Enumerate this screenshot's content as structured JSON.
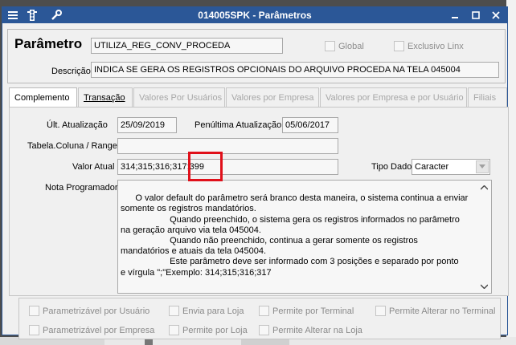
{
  "window": {
    "title": "014005SPK - Parâmetros",
    "accent": "#2b5797"
  },
  "toolbar_icons": [
    "list-icon",
    "traffic-light-icon",
    "wrench-icon"
  ],
  "header": {
    "parametro_label": "Parâmetro",
    "parametro_value": "UTILIZA_REG_CONV_PROCEDA",
    "global_label": "Global",
    "exclusivo_label": "Exclusivo Linx",
    "descricao_label": "Descrição",
    "descricao_value": "INDICA SE GERA OS REGISTROS OPCIONAIS DO ARQUIVO PROCEDA NA TELA 045004"
  },
  "tabs": [
    {
      "label": "Complemento"
    },
    {
      "label": "Transação"
    },
    {
      "label": "Valores Por Usuários"
    },
    {
      "label": "Valores por Empresa"
    },
    {
      "label": "Valores por Empresa e por Usuário"
    },
    {
      "label": "Filiais"
    }
  ],
  "complemento": {
    "ult_atualizacao_label": "Últ. Atualização",
    "ult_atualizacao_value": "25/09/2019",
    "penultima_label": "Penúltima Atualização",
    "penultima_value": "05/06/2017",
    "tabela_label": "Tabela.Coluna / Range",
    "tabela_value": "",
    "valor_label": "Valor Atual",
    "valor_value": "314;315;316;317;399",
    "tipo_label": "Tipo Dado",
    "tipo_value": "Caracter",
    "nota_label": "Nota Programador",
    "nota_value": "O valor default do parâmetro será branco desta maneira, o sistema continua a enviar\nsomente os registros mandatórios.\n                    Quando preenchido, o sistema gera os registros informados no parâmetro\nna geração arquivo via tela 045004.\n                    Quando não preenchido, continua a gerar somente os registros\nmandatórios e atuais da tela 045004.\n                    Este parâmetro deve ser informado com 3 posições e separado por ponto\ne vírgula \";\"Exemplo: 314;315;316;317"
  },
  "flags": {
    "row1": [
      "Parametrizável por Usuário",
      "Envia para Loja",
      "Permite por Terminal",
      "Permite Alterar no Terminal"
    ],
    "row2": [
      "Parametrizável por Empresa",
      "Permite por Loja",
      "Permite Alterar na Loja"
    ]
  }
}
